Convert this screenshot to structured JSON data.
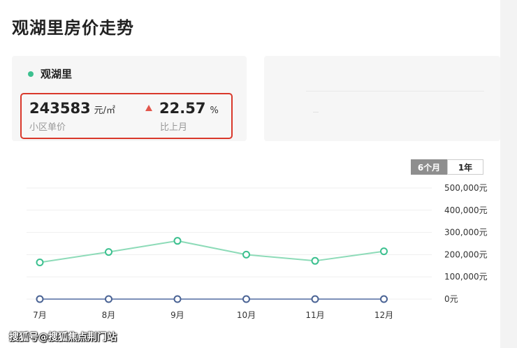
{
  "page": {
    "title": "观湖里房价走势"
  },
  "community": {
    "name": "观湖里",
    "marker_color": "#3cc08f"
  },
  "stats": {
    "price": "243583",
    "price_unit": "元/㎡",
    "price_label": "小区单价",
    "change": "22.57",
    "change_unit": "%",
    "change_label": "比上月",
    "change_direction": "up",
    "highlight_color": "#d9382b"
  },
  "range_toggle": {
    "options": [
      {
        "label": "6个月",
        "active": true
      },
      {
        "label": "1年",
        "active": false
      }
    ]
  },
  "chart_data": {
    "type": "line",
    "categories": [
      "7月",
      "8月",
      "9月",
      "10月",
      "11月",
      "12月"
    ],
    "y_ticks": [
      "0元",
      "100,000元",
      "200,000元",
      "300,000元",
      "400,000元",
      "500,000元"
    ],
    "ylim": [
      0,
      500000
    ],
    "grid": true,
    "series": [
      {
        "color": "#8ddbb8",
        "marker_color": "#3cc08f",
        "values": [
          165000,
          212000,
          262000,
          200000,
          172000,
          215000
        ]
      },
      {
        "color": "#7c8fb8",
        "marker_color": "#4a6394",
        "values": [
          0,
          0,
          0,
          0,
          0,
          0
        ]
      }
    ]
  },
  "watermark": {
    "text": "搜狐号@搜狐焦点荆门站"
  }
}
